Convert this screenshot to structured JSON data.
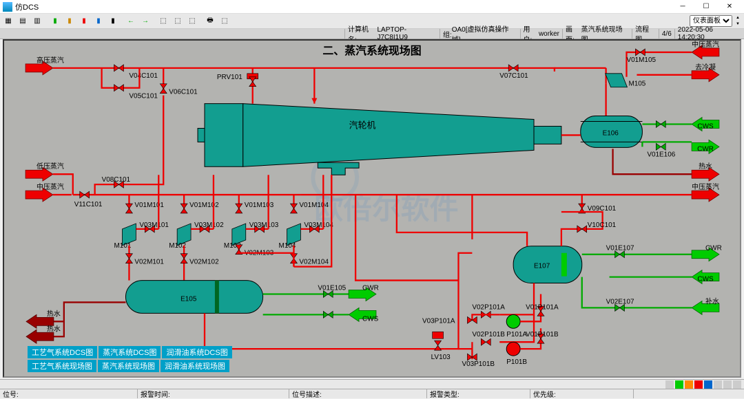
{
  "window": {
    "title": "仿DCS"
  },
  "info": {
    "computer_lbl": "计算机名:",
    "computer": "LAPTOP-J7C8I1U9",
    "group_lbl": "组:",
    "group": "OA0[虚拟仿真操作域]",
    "user_lbl": "用户:",
    "user": "worker",
    "screen_lbl": "画面:",
    "screen": "蒸汽系统现场图",
    "flow_lbl": "流程图",
    "flow": "4/6",
    "time": "2022-05-06 14:20:30",
    "panel_select": "仪表面板"
  },
  "diagram": {
    "title": "二、蒸汽系统现场图",
    "watermark": "欧倍尔软件",
    "turbine": "汽轮机",
    "E105": "E105",
    "E106": "E106",
    "E107": "E107",
    "M101": "M101",
    "M102": "M102",
    "M103": "M103",
    "M104": "M104",
    "M105": "M105",
    "PRV101": "PRV101",
    "V04C101": "V04C101",
    "V05C101": "V05C101",
    "V06C101": "V06C101",
    "V07C101": "V07C101",
    "V08C101": "V08C101",
    "V09C101": "V09C101",
    "V10C101": "V10C101",
    "V11C101": "V11C101",
    "V01M101": "V01M101",
    "V01M102": "V01M102",
    "V01M103": "V01M103",
    "V01M104": "V01M104",
    "V01M105": "V01M105",
    "V02M101": "V02M101",
    "V02M102": "V02M102",
    "V02M103": "V02M103",
    "V02M104": "V02M104",
    "V03M101": "V03M101",
    "V03M102": "V03M102",
    "V03M103": "V03M103",
    "V03M104": "V03M104",
    "V01E105": "V01E105",
    "V01E106": "V01E106",
    "V01E107": "V01E107",
    "V02E107": "V02E107",
    "V01P101A": "V01P101A",
    "V02P101A": "V02P101A",
    "V03P101A": "V03P101A",
    "V01P101B": "V01P101B",
    "V02P101B": "V02P101B",
    "V03P101B": "V03P101B",
    "P101A": "P101A",
    "P101B": "P101B",
    "LV103": "LV103",
    "hp_steam": "高压蒸汽",
    "mp_steam": "中压蒸汽",
    "lp_steam": "低压蒸汽",
    "to_cond": "去冷凝",
    "CWS": "CWS",
    "CWR": "CWR",
    "hot_water": "热水",
    "makeup": "补水"
  },
  "nav": {
    "r1c1": "工艺气系统DCS图",
    "r1c2": "蒸汽系统DCS图",
    "r1c3": "润滑油系统DCS图",
    "r2c1": "工艺气系统现场图",
    "r2c2": "蒸汽系统现场图",
    "r2c3": "润滑油系统现场图"
  },
  "status": {
    "tag_lbl": "位号:",
    "alarm_time_lbl": "报警时间:",
    "alarm_type_lbl": "报警类型:",
    "tag_desc_lbl": "位号描述:",
    "priority_lbl": "优先级:"
  }
}
